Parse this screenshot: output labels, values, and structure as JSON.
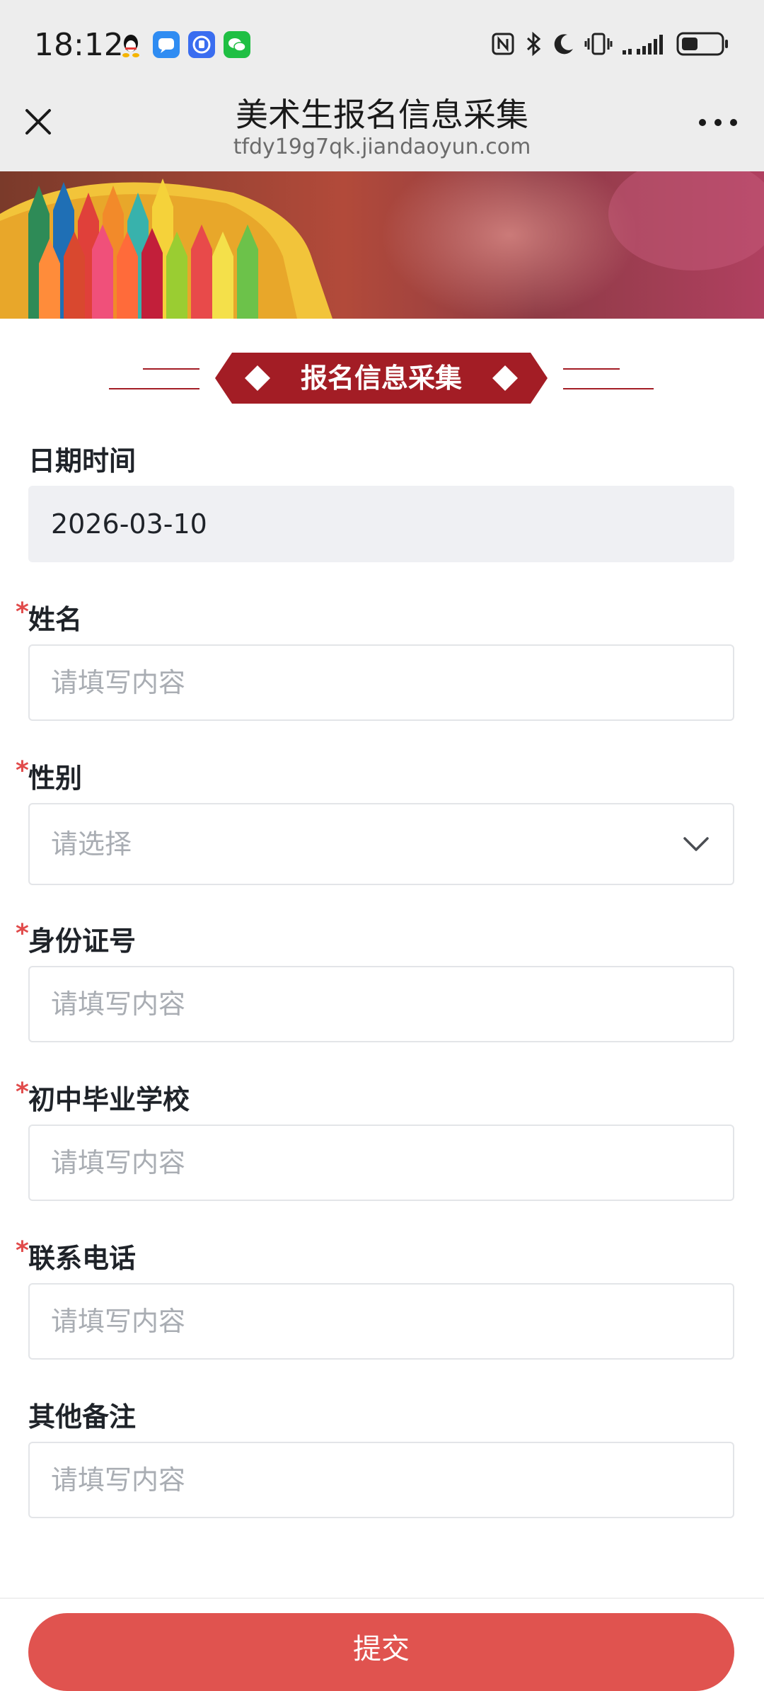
{
  "status_bar": {
    "time": "18:12",
    "app_icons": [
      "qq-icon",
      "message-icon",
      "app-shield-icon",
      "wechat-icon"
    ],
    "right_icons": [
      "nfc-icon",
      "bluetooth-icon",
      "moon-icon",
      "vibrate-icon",
      "signal-icon",
      "battery-icon"
    ]
  },
  "header": {
    "title": "美术生报名信息采集",
    "url": "tfdy19g7qk.jiandaoyun.com"
  },
  "section": {
    "title": "报名信息采集"
  },
  "form": {
    "fields": [
      {
        "label": "日期时间",
        "required": false,
        "value": "2026-03-10",
        "placeholder": "",
        "type": "text",
        "readonly": true
      },
      {
        "label": "姓名",
        "required": true,
        "value": "",
        "placeholder": "请填写内容",
        "type": "text"
      },
      {
        "label": "性别",
        "required": true,
        "value": "",
        "placeholder": "请选择",
        "type": "select"
      },
      {
        "label": "身份证号",
        "required": true,
        "value": "",
        "placeholder": "请填写内容",
        "type": "text"
      },
      {
        "label": "初中毕业学校",
        "required": true,
        "value": "",
        "placeholder": "请填写内容",
        "type": "text"
      },
      {
        "label": "联系电话",
        "required": true,
        "value": "",
        "placeholder": "请填写内容",
        "type": "text"
      },
      {
        "label": "其他备注",
        "required": false,
        "value": "",
        "placeholder": "请填写内容",
        "type": "text"
      }
    ],
    "required_mark": "*",
    "submit_label": "提交"
  },
  "colors": {
    "accent_red": "#a31d25",
    "submit_red": "#e0534f",
    "required_red": "#e14b4b",
    "placeholder_grey": "#a9adb3"
  }
}
